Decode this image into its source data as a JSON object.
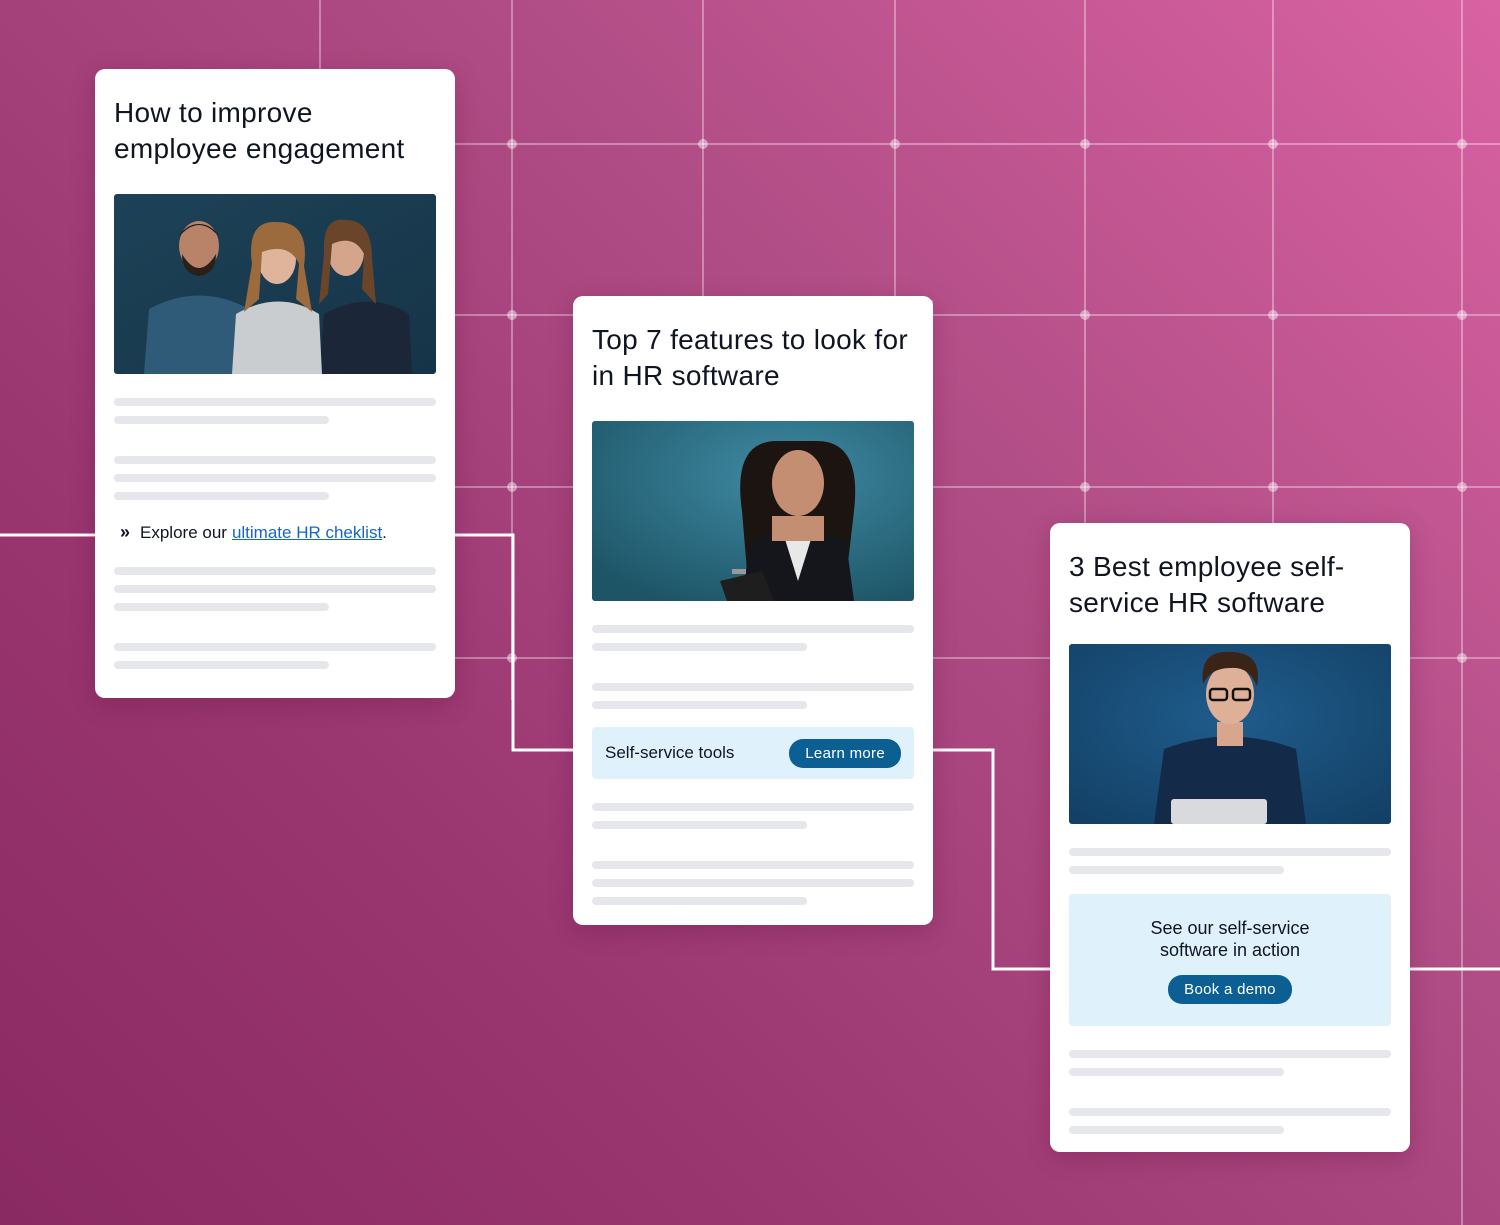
{
  "colors": {
    "background": "#b24e87",
    "card": "#ffffff",
    "link": "#1666c5",
    "button": "#0b5f93",
    "cta_background": "#dff1fb",
    "placeholder_line": "#e6e7ea"
  },
  "cards": [
    {
      "title": "How to improve employee engagement",
      "photo": "three-coworkers-photo",
      "explore_prefix": "Explore our",
      "explore_link": "ultimate HR cheklist",
      "explore_suffix": "."
    },
    {
      "title": "Top 7 features to look for in HR software",
      "photo": "woman-with-clipboard-photo",
      "cta_label": "Self-service tools",
      "cta_button": "Learn more"
    },
    {
      "title": "3 Best employee self-service HR software",
      "photo": "man-with-laptop-photo",
      "cta_text": "See our self-service software in action",
      "cta_button": "Book a demo"
    }
  ]
}
